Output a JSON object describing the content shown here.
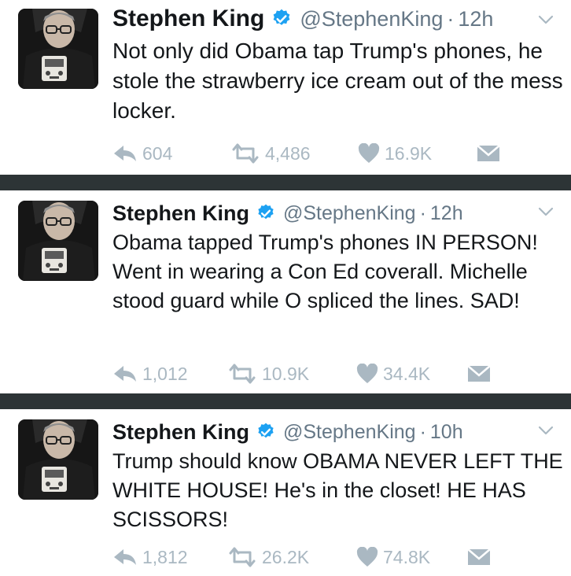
{
  "tweets": [
    {
      "name": "Stephen King",
      "handle": "@StephenKing",
      "separator": "·",
      "time": "12h",
      "text": "Not only did Obama tap Trump's phones, he stole the strawberry ice cream out of the mess locker.",
      "replies": "604",
      "retweets": "4,486",
      "likes": "16.9K"
    },
    {
      "name": "Stephen King",
      "handle": "@StephenKing",
      "separator": "·",
      "time": "12h",
      "text": "Obama tapped Trump's phones IN PERSON! Went in wearing a Con Ed coverall. Michelle stood guard while O spliced the lines. SAD!",
      "replies": "1,012",
      "retweets": "10.9K",
      "likes": "34.4K"
    },
    {
      "name": "Stephen King",
      "handle": "@StephenKing",
      "separator": "·",
      "time": "10h",
      "text": "Trump should know OBAMA NEVER LEFT THE WHITE HOUSE! He's in the closet! HE HAS SCISSORS!",
      "replies": "1,812",
      "retweets": "26.2K",
      "likes": "74.8K"
    }
  ],
  "icons": {
    "verified": "verified-badge-icon",
    "chevron": "chevron-down-icon",
    "reply": "reply-icon",
    "retweet": "retweet-icon",
    "like": "heart-icon",
    "dm": "envelope-icon"
  },
  "colors": {
    "accent": "#1da1f2",
    "action_gray": "#aab8c2",
    "secondary_text": "#657786",
    "divider": "#2d3436"
  }
}
